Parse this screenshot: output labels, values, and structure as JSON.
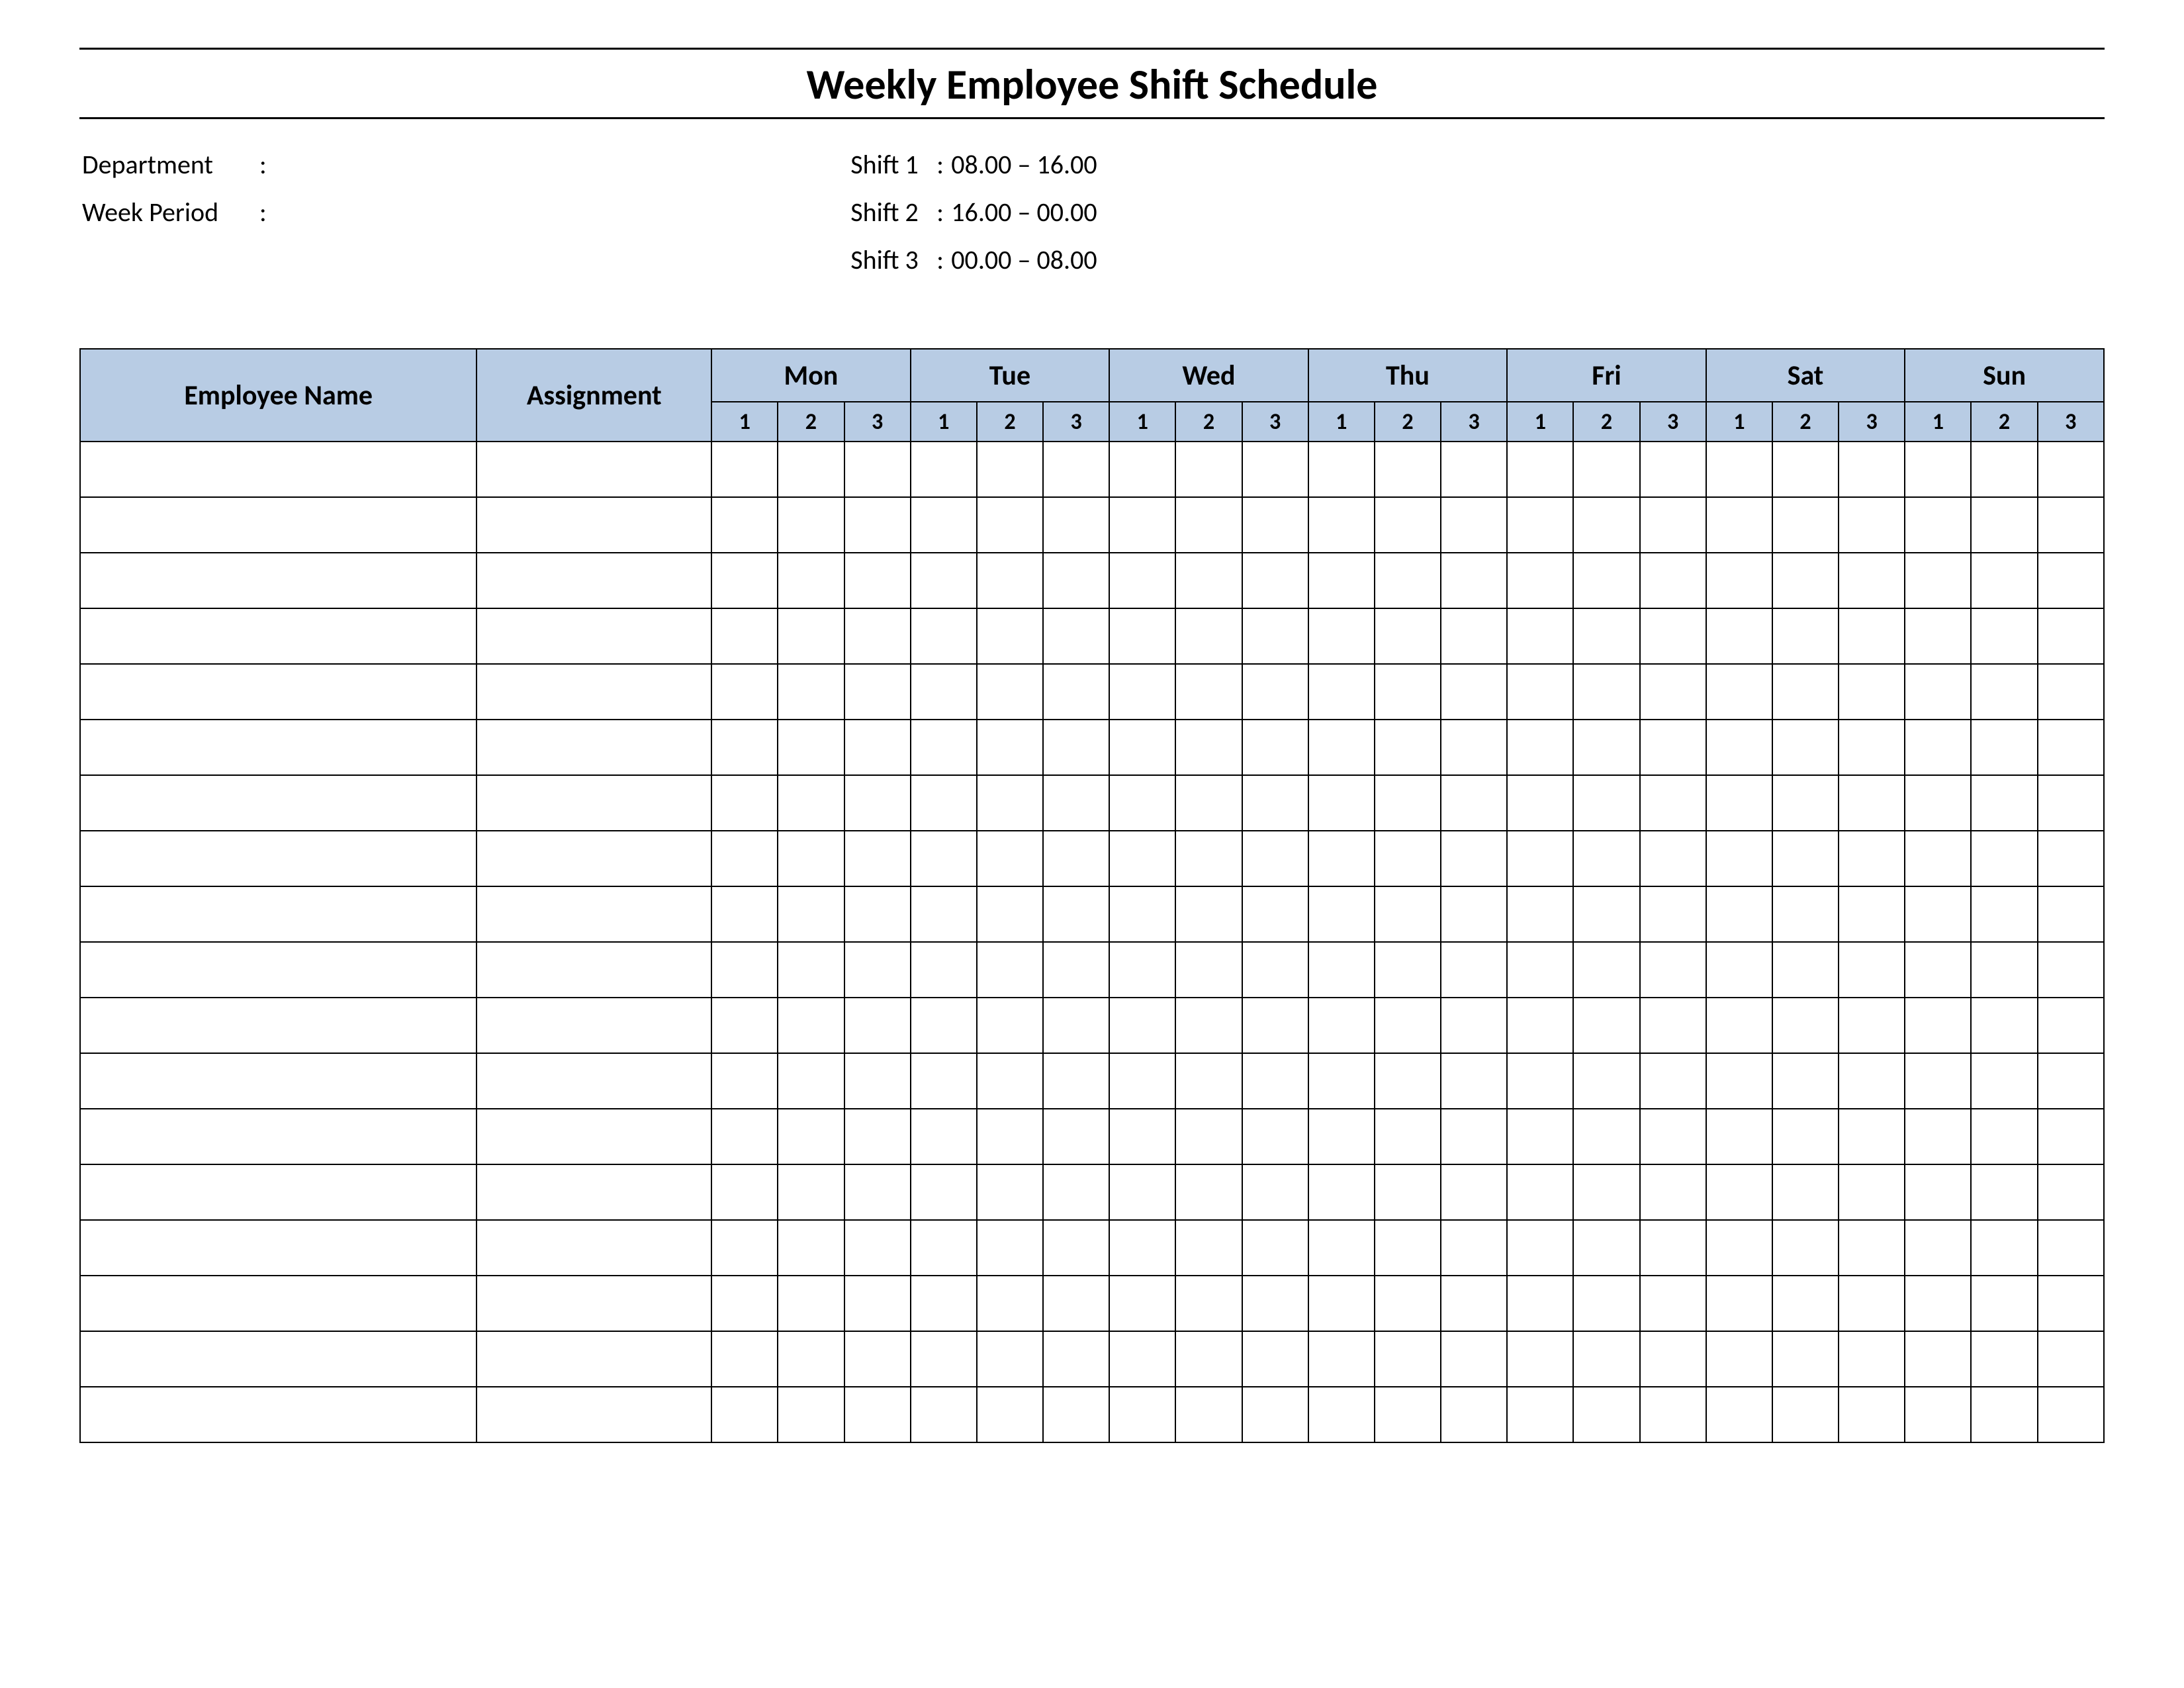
{
  "title": "Weekly Employee Shift Schedule",
  "info": {
    "department_label": "Department",
    "department_value": "",
    "week_period_label": "Week  Period",
    "week_period_value": "",
    "shifts": [
      {
        "label": "Shift 1",
        "value": "08.00  – 16.00"
      },
      {
        "label": "Shift 2",
        "value": "16.00  – 00.00"
      },
      {
        "label": "Shift 3",
        "value": "00.00  – 08.00"
      }
    ]
  },
  "table": {
    "employee_header": "Employee Name",
    "assignment_header": "Assignment",
    "days": [
      "Mon",
      "Tue",
      "Wed",
      "Thu",
      "Fri",
      "Sat",
      "Sun"
    ],
    "sub": [
      "1",
      "2",
      "3"
    ],
    "rows": 18
  }
}
